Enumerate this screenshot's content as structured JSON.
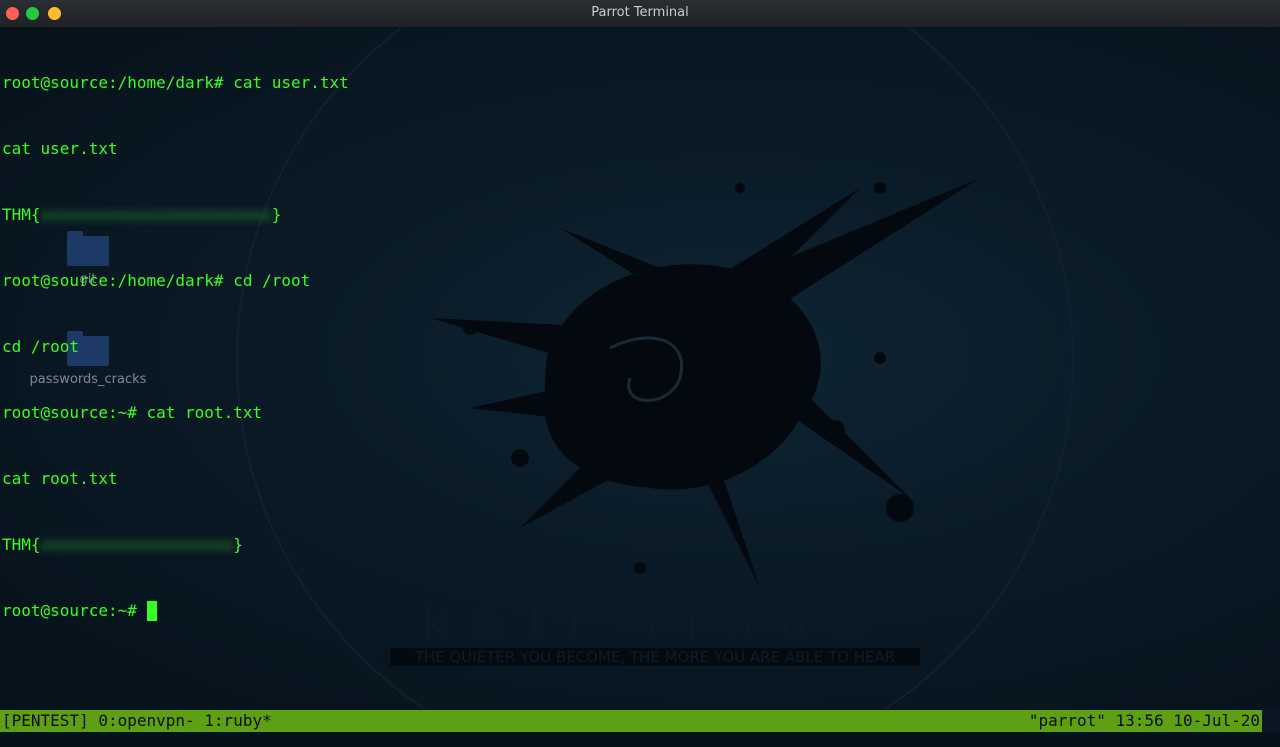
{
  "window": {
    "title": "Parrot Terminal"
  },
  "desktop": {
    "icons": [
      {
        "label": "git"
      },
      {
        "label": "passwords_cracks"
      }
    ],
    "wallpaper": {
      "brand": "kali linux",
      "tagline": "THE QUIETER YOU BECOME, THE MORE YOU ARE ABLE TO HEAR"
    }
  },
  "terminal": {
    "lines": [
      {
        "prompt": "root@source:/home/dark# ",
        "text": "cat user.txt"
      },
      {
        "text": "cat user.txt"
      },
      {
        "prefix": "THM{",
        "redacted": "xxxxxxxxxxxxxxxxxxxxxxxx",
        "suffix": "}"
      },
      {
        "prompt": "root@source:/home/dark# ",
        "text": "cd /root"
      },
      {
        "text": "cd /root"
      },
      {
        "prompt": "root@source:~# ",
        "text": "cat root.txt"
      },
      {
        "text": "cat root.txt"
      },
      {
        "prefix": "THM{",
        "redacted": "xxxxxxxxxxxxxxxxxxxx",
        "suffix": "}"
      },
      {
        "prompt": "root@source:~# ",
        "text": ""
      }
    ]
  },
  "statusbar": {
    "left": "[PENTEST] 0:openvpn- 1:ruby*",
    "right": "\"parrot\" 13:56 10-Jul-20"
  },
  "colors": {
    "terminal_text": "#38ff22",
    "status_bg": "#5da013",
    "background": "#0a1722"
  }
}
